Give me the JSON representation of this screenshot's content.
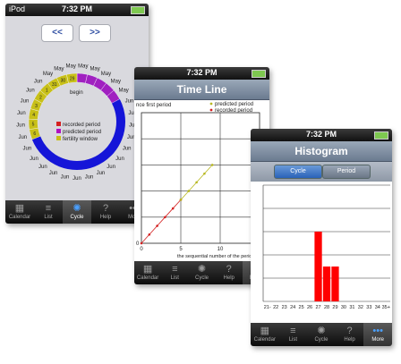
{
  "status": {
    "carrier": "iPod",
    "time": "7:32 PM"
  },
  "tabs": [
    {
      "label": "Calendar",
      "icon": "calendar-icon",
      "glyph": "▦"
    },
    {
      "label": "List",
      "icon": "list-icon",
      "glyph": "≡"
    },
    {
      "label": "Cycle",
      "icon": "cycle-icon",
      "glyph": "✺"
    },
    {
      "label": "Help",
      "icon": "help-icon",
      "glyph": "?"
    },
    {
      "label": "More",
      "icon": "more-icon",
      "glyph": "•••"
    }
  ],
  "cycle_screen": {
    "prev_label": "<<",
    "next_label": ">>",
    "ring_labels": [
      "May",
      "May",
      "May",
      "May",
      "May",
      "Jun",
      "Jun",
      "Jun",
      "Jun",
      "Jun",
      "Jun",
      "Jun",
      "Jun",
      "Jun",
      "Jun",
      "Jun",
      "Jun",
      "Jun",
      "Jun",
      "Jun",
      "Jun",
      "Jun",
      "Jun",
      "Jun",
      "Jun",
      "Jun",
      "May",
      "May",
      "May"
    ],
    "begin_label": "begin",
    "day_numbers": [
      "29",
      "30",
      "31",
      "1",
      "2",
      "3",
      "4",
      "5",
      "6"
    ],
    "legend": [
      {
        "label": "recorded period",
        "color": "#d42020"
      },
      {
        "label": "predicted period",
        "color": "#b010c0"
      },
      {
        "label": "fertility window",
        "color": "#c8c018"
      }
    ],
    "colors": {
      "ring": "#1515d8",
      "predicted": "#a020c0",
      "fertility": "#c8c018"
    }
  },
  "timeline_screen": {
    "title": "Time Line",
    "ylabel_partial": "nce first period",
    "xlabel": "the sequential number of the periods",
    "legend": [
      {
        "label": "predicted period",
        "color": "#b8b820"
      },
      {
        "label": "recorded period",
        "color": "#d42020"
      }
    ]
  },
  "histogram_screen": {
    "title": "Histogram",
    "segments": [
      {
        "label": "Cycle",
        "active": true
      },
      {
        "label": "Period",
        "active": false
      }
    ]
  },
  "chart_data": [
    {
      "type": "line",
      "title": "Time Line",
      "xlabel": "the sequential number of the periods",
      "ylabel": "nce first period",
      "xlim": [
        0,
        15
      ],
      "xticks": [
        "0",
        "5",
        "10",
        "15"
      ],
      "grid": true,
      "series": [
        {
          "name": "recorded period",
          "color": "#d42020",
          "x": [
            0,
            1,
            2,
            3,
            4,
            5
          ],
          "y": [
            0,
            1,
            2,
            3,
            4,
            5
          ]
        },
        {
          "name": "predicted period",
          "color": "#b8b820",
          "x": [
            5,
            6,
            7,
            8,
            9
          ],
          "y": [
            5,
            6,
            7,
            8,
            9
          ]
        }
      ]
    },
    {
      "type": "bar",
      "categories": [
        "21-",
        "22",
        "23",
        "24",
        "25",
        "26",
        "27",
        "28",
        "29",
        "30",
        "31",
        "32",
        "33",
        "34",
        "35+"
      ],
      "values": [
        0,
        0,
        0,
        0,
        0,
        0,
        3,
        1.5,
        1.5,
        0,
        0,
        0,
        0,
        0,
        0
      ],
      "ylim": [
        0,
        5
      ],
      "grid": true,
      "color": "#ff0000"
    }
  ]
}
